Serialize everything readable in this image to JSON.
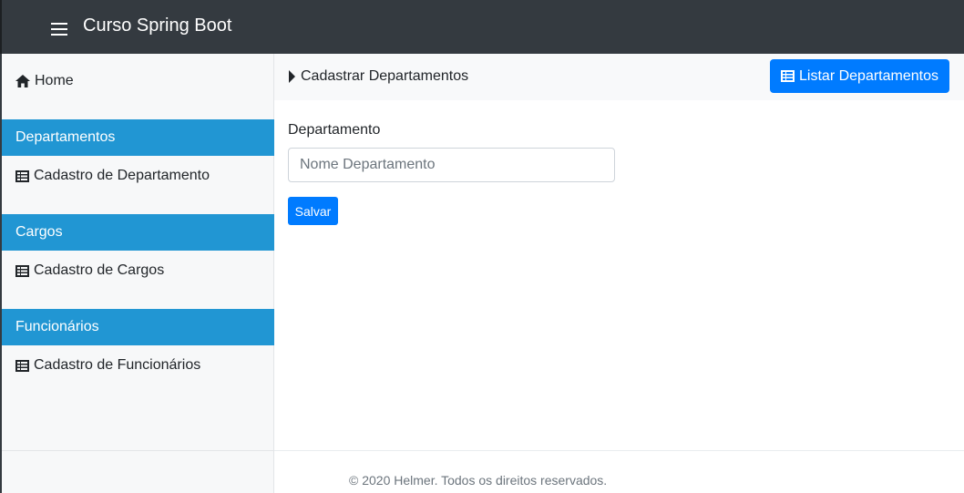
{
  "navbar": {
    "brand": "Curso Spring Boot"
  },
  "sidebar": {
    "home_label": "Home",
    "sections": [
      {
        "title": "Departamentos",
        "item": "Cadastro de Departamento"
      },
      {
        "title": "Cargos",
        "item": "Cadastro de Cargos"
      },
      {
        "title": "Funcionários",
        "item": "Cadastro de Funcionários"
      }
    ]
  },
  "breadcrumb": {
    "label": "Cadastrar Departamentos",
    "action_label": "Listar Departamentos"
  },
  "form": {
    "field_label": "Departamento",
    "field_placeholder": "Nome Departamento",
    "field_value": "",
    "submit_label": "Salvar"
  },
  "footer": {
    "text": "© 2020 Helmer. Todos os direitos reservados."
  },
  "colors": {
    "navbar": "#343a40",
    "sidebar_header": "#2196d3",
    "primary": "#007bff"
  },
  "icons": {
    "menu": "hamburger-icon",
    "home": "home-icon",
    "table": "table-icon",
    "caret": "caret-right-icon"
  }
}
